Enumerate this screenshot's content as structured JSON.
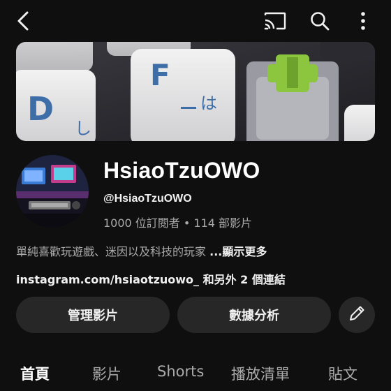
{
  "header": {
    "back_icon": "back-arrow-icon",
    "cast_icon": "cast-icon",
    "search_icon": "search-icon",
    "more_icon": "more-vert-icon"
  },
  "banner": {
    "keycap_labels": [
      "D",
      "し",
      "F",
      "は"
    ]
  },
  "channel": {
    "name": "HsiaoTzuOWO",
    "handle": "@HsiaoTzuOWO",
    "stats": "1000 位訂閱者 • 114 部影片",
    "description": "單純喜歡玩遊戲、迷因以及科技的玩家",
    "description_more": "...顯示更多",
    "links": "instagram.com/hsiaotzuowo_ 和另外 2 個連結"
  },
  "actions": {
    "manage_label": "管理影片",
    "analytics_label": "數據分析",
    "edit_icon": "pencil-icon"
  },
  "tabs": [
    {
      "label": "首頁",
      "active": true
    },
    {
      "label": "影片",
      "active": false
    },
    {
      "label": "Shorts",
      "active": false
    },
    {
      "label": "播放清單",
      "active": false
    },
    {
      "label": "貼文",
      "active": false
    }
  ],
  "colors": {
    "background": "#0f0f0f",
    "button_bg": "#272727",
    "keycap_accent": "#8cc63f",
    "keycap_letter": "#3d6ea8"
  }
}
